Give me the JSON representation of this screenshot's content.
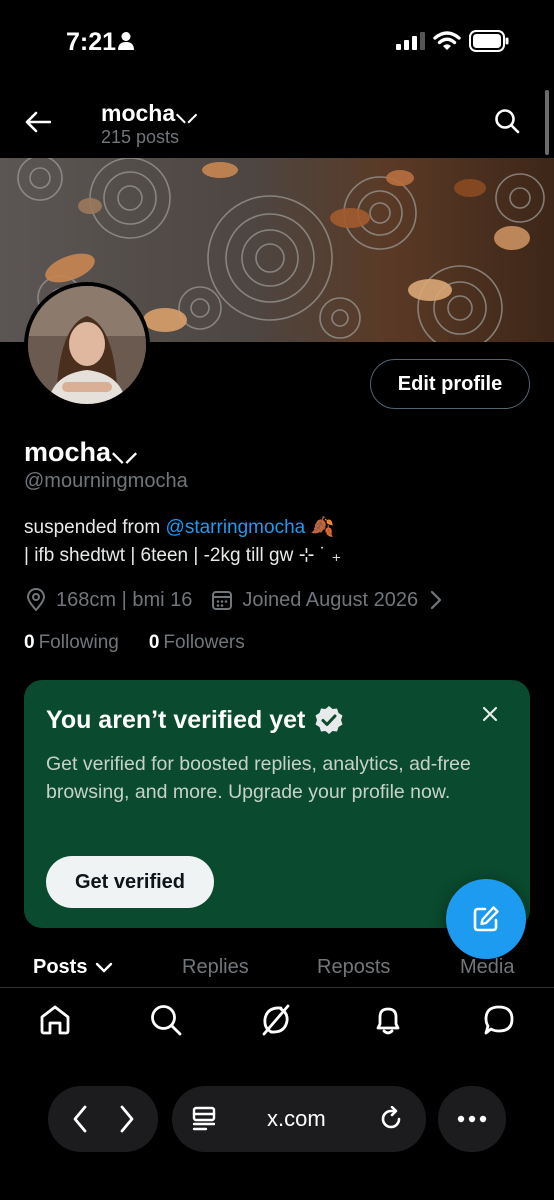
{
  "status": {
    "time": "7:21",
    "icons": [
      "person-icon",
      "signal-icon",
      "wifi-icon",
      "battery-icon"
    ]
  },
  "header": {
    "name": "mocha⸜⸝",
    "posts": "215 posts"
  },
  "profile": {
    "display_name": "mocha⸜⸝",
    "handle": "@mourningmocha",
    "edit_label": "Edit profile",
    "bio_prefix": "suspended from ",
    "bio_link": "@starringmocha",
    "bio_suffix": " 🍂",
    "bio_line2": " | ifb shedtwt | 6teen | -2kg till gw ⊹ ˙ ₊",
    "location": "168cm | bmi 16",
    "joined": "Joined August 2026",
    "following_count": "0",
    "following_label": "Following",
    "followers_count": "0",
    "followers_label": "Followers"
  },
  "verify_card": {
    "title": "You aren’t verified yet",
    "description": "Get verified for boosted replies, analytics, ad-free browsing, and more. Upgrade your profile now.",
    "button": "Get verified",
    "background": "#0a4a2e"
  },
  "tabs": [
    {
      "label": "Posts",
      "active": true
    },
    {
      "label": "Replies",
      "active": false
    },
    {
      "label": "Reposts",
      "active": false
    },
    {
      "label": "Media",
      "active": false
    }
  ],
  "nav": [
    "home-icon",
    "search-icon",
    "grok-icon",
    "bell-icon",
    "message-icon"
  ],
  "browser": {
    "url": "x.com"
  },
  "colors": {
    "accent": "#1d9bf0",
    "muted": "#71767b",
    "background": "#000000"
  }
}
